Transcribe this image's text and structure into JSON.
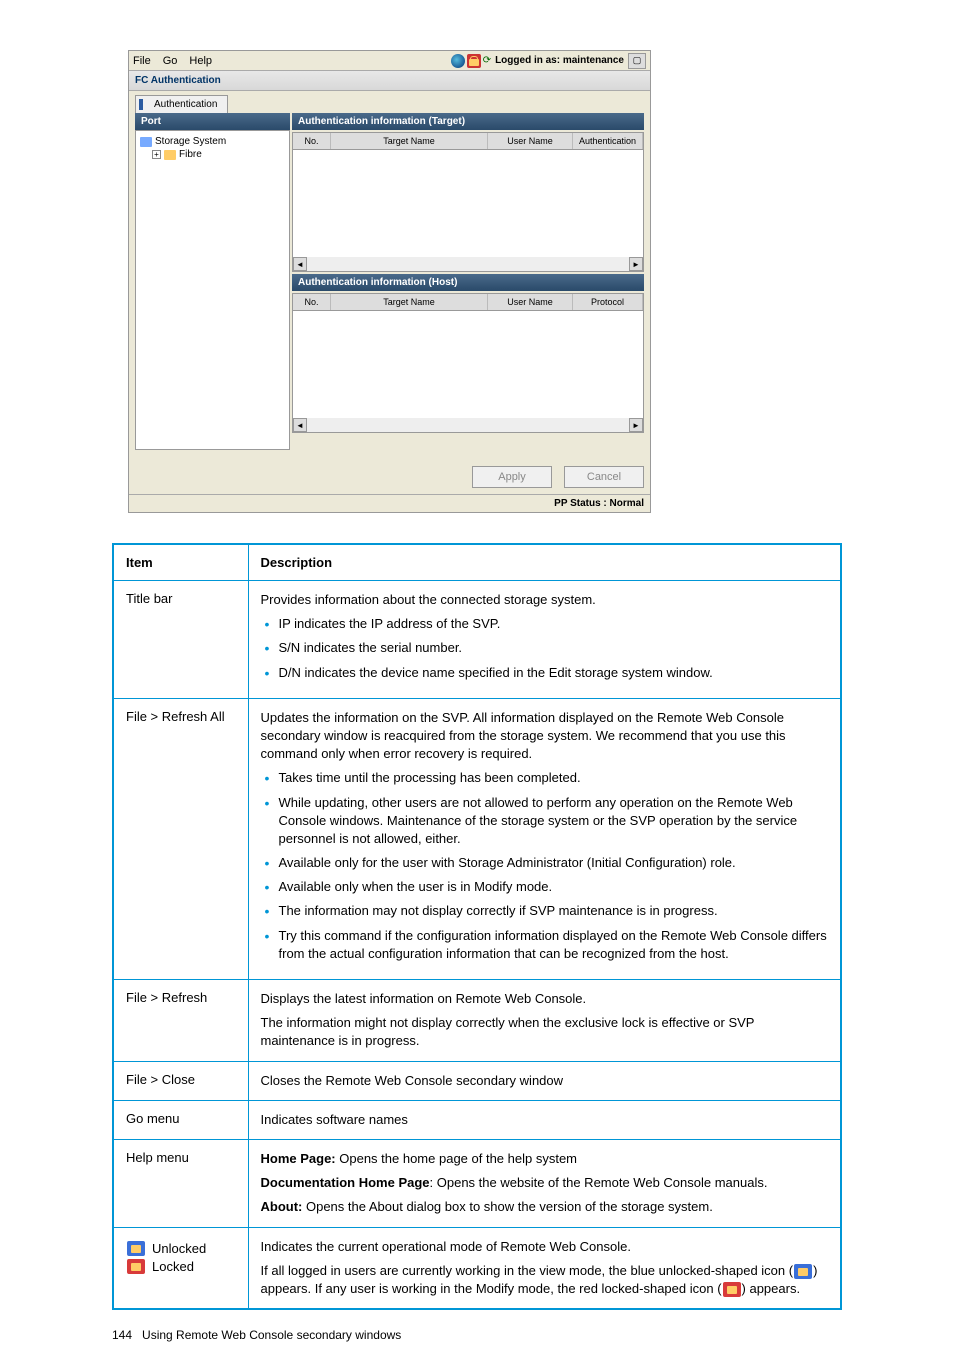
{
  "window": {
    "menu": {
      "file": "File",
      "go": "Go",
      "help": "Help"
    },
    "login_status": "Logged in as: maintenance",
    "fc_header": "FC Authentication",
    "tab": "Authentication",
    "left_header": "Port",
    "tree": {
      "storage": "Storage System",
      "fibre": "Fibre"
    },
    "auth_target": "Authentication information (Target)",
    "auth_host": "Authentication information (Host)",
    "cols": {
      "no": "No.",
      "target_name": "Target Name",
      "user_name": "User Name",
      "authentication": "Authentication",
      "protocol": "Protocol"
    },
    "buttons": {
      "apply": "Apply",
      "cancel": "Cancel"
    },
    "status": "PP Status : Normal"
  },
  "table": {
    "headers": {
      "item": "Item",
      "description": "Description"
    },
    "rows": {
      "title_bar": {
        "item": "Title bar",
        "intro": "Provides information about the connected storage system.",
        "bullets": [
          "IP indicates the IP address of the SVP.",
          "S/N indicates the serial number.",
          "D/N indicates the device name specified in the Edit storage system window."
        ]
      },
      "refresh_all": {
        "item": "File > Refresh All",
        "intro": "Updates the information on the SVP. All information displayed on the Remote Web Console secondary window is reacquired from the storage system. We recommend that you use this command only when error recovery is required.",
        "bullets": [
          "Takes time until the processing has been completed.",
          "While updating, other users are not allowed to perform any operation on the Remote Web Console windows. Maintenance of the storage system or the SVP operation by the service personnel is not allowed, either.",
          "Available only for the user with Storage Administrator (Initial Configuration) role.",
          "Available only when the user is in Modify mode.",
          "The information may not display correctly if SVP maintenance is in progress.",
          "Try this command if the configuration information displayed on the Remote Web Console differs from the actual configuration information that can be recognized from the host."
        ]
      },
      "refresh": {
        "item": "File > Refresh",
        "p1": "Displays the latest information on Remote Web Console.",
        "p2": "The information might not display correctly when the exclusive lock is effective or SVP maintenance is in progress."
      },
      "close": {
        "item": "File > Close",
        "p1": "Closes the Remote Web Console secondary window"
      },
      "go": {
        "item": "Go menu",
        "p1": "Indicates software names"
      },
      "help": {
        "item": "Help menu",
        "home_label": "Home Page:",
        "home_text": " Opens the home page of the help system",
        "doc_label": "Documentation Home Page",
        "doc_text": ": Opens the website of the Remote Web Console manuals.",
        "about_label": "About:",
        "about_text": " Opens the About dialog box to show the version of the storage system."
      },
      "lock": {
        "unlocked": "Unlocked",
        "locked": "Locked",
        "p1": "Indicates the current operational mode of Remote Web Console.",
        "p2a": "If all logged in users are currently working in the view mode, the blue unlocked-shaped icon (",
        "p2b": ") appears. If any user is working in the Modify mode, the red locked-shaped icon (",
        "p2c": ") appears."
      }
    }
  },
  "footer": {
    "page": "144",
    "text": "Using Remote Web Console secondary windows"
  }
}
